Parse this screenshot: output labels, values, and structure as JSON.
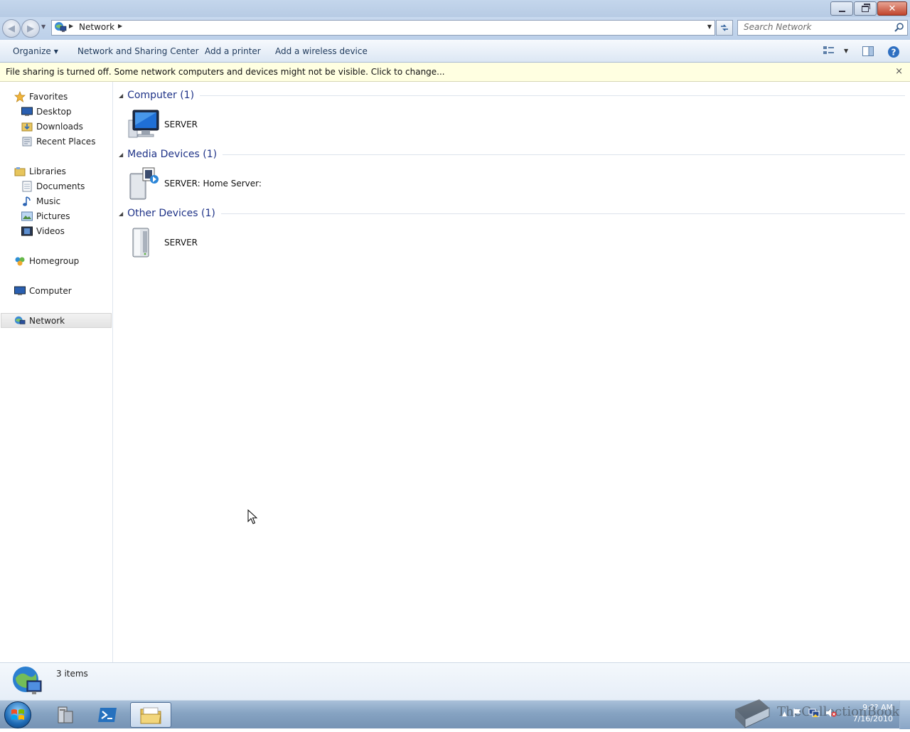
{
  "window": {
    "controls": {
      "minimize": "minimize",
      "maximize": "restore",
      "close": "close"
    }
  },
  "address_bar": {
    "location": "Network",
    "search_placeholder": "Search Network"
  },
  "command_bar": {
    "organize": "Organize",
    "network_sharing_center": "Network and Sharing Center",
    "add_printer": "Add a printer",
    "add_wireless": "Add a wireless device"
  },
  "info_bar": {
    "message": "File sharing is turned off. Some network computers and devices might not be visible. Click to change...",
    "close_glyph": "×"
  },
  "nav_pane": {
    "favorites": {
      "label": "Favorites",
      "items": [
        "Desktop",
        "Downloads",
        "Recent Places"
      ]
    },
    "libraries": {
      "label": "Libraries",
      "items": [
        "Documents",
        "Music",
        "Pictures",
        "Videos"
      ]
    },
    "homegroup": "Homegroup",
    "computer": "Computer",
    "network": "Network"
  },
  "content": {
    "groups": [
      {
        "title": "Computer (1)",
        "items": [
          "SERVER"
        ]
      },
      {
        "title": "Media Devices (1)",
        "items": [
          "SERVER: Home Server:"
        ]
      },
      {
        "title": "Other Devices (1)",
        "items": [
          "SERVER"
        ]
      }
    ]
  },
  "details_pane": {
    "summary": "3 items"
  },
  "taskbar": {
    "clock_time": "9:?? AM",
    "clock_date": "7/16/2010",
    "watermark": "TheCollectionBook"
  },
  "colors": {
    "group_title": "#1e3287",
    "command_text": "#1e395b",
    "info_bar_bg": "#ffffe1",
    "title_bar": "#c4d6ec"
  }
}
